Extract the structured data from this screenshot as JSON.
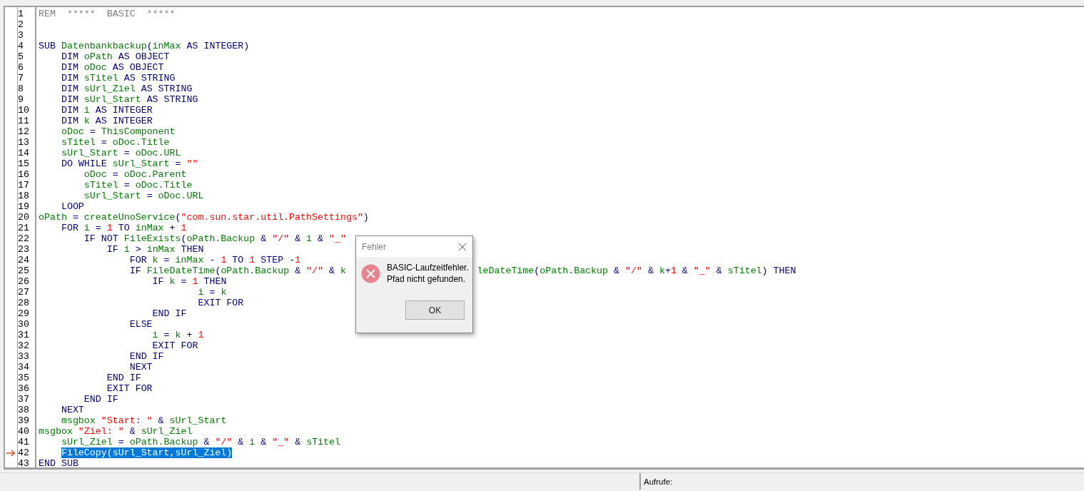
{
  "editor": {
    "lines": [
      {
        "n": "1",
        "current": false,
        "c": [
          {
            "kind": "rem",
            "t": "REM  *****  BASIC  *****"
          }
        ]
      },
      {
        "n": "2",
        "current": false
      },
      {
        "n": "3",
        "current": false
      },
      {
        "n": "4",
        "current": false,
        "c": [
          {
            "kind": "kw",
            "t": "SUB "
          },
          {
            "kind": "id",
            "t": "Datenbankbackup"
          },
          {
            "kind": "op",
            "t": "("
          },
          {
            "kind": "id",
            "t": "inMax"
          },
          {
            "kind": "kw",
            "t": " AS INTEGER)"
          }
        ]
      },
      {
        "n": "5",
        "current": false,
        "c": [
          {
            "kind": "kw",
            "t": "    DIM "
          },
          {
            "kind": "id",
            "t": "oPath"
          },
          {
            "kind": "kw",
            "t": " AS OBJECT"
          }
        ]
      },
      {
        "n": "6",
        "current": false,
        "c": [
          {
            "kind": "kw",
            "t": "    DIM "
          },
          {
            "kind": "id",
            "t": "oDoc"
          },
          {
            "kind": "kw",
            "t": " AS OBJECT"
          }
        ]
      },
      {
        "n": "7",
        "current": false,
        "c": [
          {
            "kind": "kw",
            "t": "    DIM "
          },
          {
            "kind": "id",
            "t": "sTitel"
          },
          {
            "kind": "kw",
            "t": " AS STRING"
          }
        ]
      },
      {
        "n": "8",
        "current": false,
        "c": [
          {
            "kind": "kw",
            "t": "    DIM "
          },
          {
            "kind": "id",
            "t": "sUrl_Ziel"
          },
          {
            "kind": "kw",
            "t": " AS STRING"
          }
        ]
      },
      {
        "n": "9",
        "current": false,
        "c": [
          {
            "kind": "kw",
            "t": "    DIM "
          },
          {
            "kind": "id",
            "t": "sUrl_Start"
          },
          {
            "kind": "kw",
            "t": " AS STRING"
          }
        ]
      },
      {
        "n": "10",
        "current": false,
        "c": [
          {
            "kind": "kw",
            "t": "    DIM "
          },
          {
            "kind": "id",
            "t": "i"
          },
          {
            "kind": "kw",
            "t": " AS INTEGER"
          }
        ]
      },
      {
        "n": "11",
        "current": false,
        "c": [
          {
            "kind": "kw",
            "t": "    DIM "
          },
          {
            "kind": "id",
            "t": "k"
          },
          {
            "kind": "kw",
            "t": " AS INTEGER"
          }
        ]
      },
      {
        "n": "12",
        "current": false,
        "c": [
          {
            "kind": "id",
            "t": "    oDoc"
          },
          {
            "kind": "op",
            "t": " = "
          },
          {
            "kind": "id",
            "t": "ThisComponent"
          }
        ]
      },
      {
        "n": "13",
        "current": false,
        "c": [
          {
            "kind": "id",
            "t": "    sTitel"
          },
          {
            "kind": "op",
            "t": " = "
          },
          {
            "kind": "id",
            "t": "oDoc.Title"
          }
        ]
      },
      {
        "n": "14",
        "current": false,
        "c": [
          {
            "kind": "id",
            "t": "    sUrl_Start"
          },
          {
            "kind": "op",
            "t": " = "
          },
          {
            "kind": "id",
            "t": "oDoc.URL"
          }
        ]
      },
      {
        "n": "15",
        "current": false,
        "c": [
          {
            "kind": "kw",
            "t": "    DO WHILE "
          },
          {
            "kind": "id",
            "t": "sUrl_Start"
          },
          {
            "kind": "op",
            "t": " = "
          },
          {
            "kind": "str",
            "t": "\"\""
          }
        ]
      },
      {
        "n": "16",
        "current": false,
        "c": [
          {
            "kind": "id",
            "t": "        oDoc"
          },
          {
            "kind": "op",
            "t": " = "
          },
          {
            "kind": "id",
            "t": "oDoc.Parent"
          }
        ]
      },
      {
        "n": "17",
        "current": false,
        "c": [
          {
            "kind": "id",
            "t": "        sTitel"
          },
          {
            "kind": "op",
            "t": " = "
          },
          {
            "kind": "id",
            "t": "oDoc.Title"
          }
        ]
      },
      {
        "n": "18",
        "current": false,
        "c": [
          {
            "kind": "id",
            "t": "        sUrl_Start"
          },
          {
            "kind": "op",
            "t": " = "
          },
          {
            "kind": "id",
            "t": "oDoc.URL"
          }
        ]
      },
      {
        "n": "19",
        "current": false,
        "c": [
          {
            "kind": "kw",
            "t": "    LOOP"
          }
        ]
      },
      {
        "n": "20",
        "current": false,
        "c": [
          {
            "kind": "id",
            "t": "oPath"
          },
          {
            "kind": "op",
            "t": " = "
          },
          {
            "kind": "id",
            "t": "createUnoService"
          },
          {
            "kind": "op",
            "t": "("
          },
          {
            "kind": "str",
            "t": "\"com.sun.star.util.PathSettings\""
          },
          {
            "kind": "op",
            "t": ")"
          }
        ]
      },
      {
        "n": "21",
        "current": false,
        "c": [
          {
            "kind": "kw",
            "t": "    FOR "
          },
          {
            "kind": "id",
            "t": "i"
          },
          {
            "kind": "op",
            "t": " = "
          },
          {
            "kind": "num",
            "t": "1"
          },
          {
            "kind": "kw",
            "t": " TO "
          },
          {
            "kind": "id",
            "t": "inMax"
          },
          {
            "kind": "op",
            "t": " + "
          },
          {
            "kind": "num",
            "t": "1"
          }
        ]
      },
      {
        "n": "22",
        "current": false,
        "c": [
          {
            "kind": "kw",
            "t": "        IF NOT "
          },
          {
            "kind": "id",
            "t": "FileExists"
          },
          {
            "kind": "op",
            "t": "("
          },
          {
            "kind": "id",
            "t": "oPath.Backup"
          },
          {
            "kind": "op",
            "t": " & "
          },
          {
            "kind": "str",
            "t": "\"/\""
          },
          {
            "kind": "op",
            "t": " & "
          },
          {
            "kind": "id",
            "t": "i"
          },
          {
            "kind": "op",
            "t": " & "
          },
          {
            "kind": "str",
            "t": "\"_\""
          }
        ]
      },
      {
        "n": "23",
        "current": false,
        "c": [
          {
            "kind": "kw",
            "t": "            IF "
          },
          {
            "kind": "id",
            "t": "i"
          },
          {
            "kind": "op",
            "t": " > "
          },
          {
            "kind": "id",
            "t": "inMax"
          },
          {
            "kind": "kw",
            "t": " THEN"
          }
        ]
      },
      {
        "n": "24",
        "current": false,
        "c": [
          {
            "kind": "kw",
            "t": "                FOR "
          },
          {
            "kind": "id",
            "t": "k"
          },
          {
            "kind": "op",
            "t": " = "
          },
          {
            "kind": "id",
            "t": "inMax"
          },
          {
            "kind": "op",
            "t": " - "
          },
          {
            "kind": "num",
            "t": "1"
          },
          {
            "kind": "kw",
            "t": " TO "
          },
          {
            "kind": "num",
            "t": "1"
          },
          {
            "kind": "kw",
            "t": " STEP -"
          },
          {
            "kind": "num",
            "t": "1"
          }
        ]
      },
      {
        "n": "25",
        "current": false,
        "c": [
          {
            "kind": "kw",
            "t": "                IF "
          },
          {
            "kind": "id",
            "t": "FileDateTime"
          },
          {
            "kind": "op",
            "t": "("
          },
          {
            "kind": "id",
            "t": "oPath.Backup"
          },
          {
            "kind": "op",
            "t": " & "
          },
          {
            "kind": "str",
            "t": "\"/\""
          },
          {
            "kind": "op",
            "t": " & "
          },
          {
            "kind": "id",
            "t": "k"
          },
          {
            "kind": "covered"
          },
          {
            "kind": "id",
            "t": "leDateTime"
          },
          {
            "kind": "op",
            "t": "("
          },
          {
            "kind": "id",
            "t": "oPath.Backup"
          },
          {
            "kind": "op",
            "t": " & "
          },
          {
            "kind": "str",
            "t": "\"/\""
          },
          {
            "kind": "op",
            "t": " & "
          },
          {
            "kind": "id",
            "t": "k"
          },
          {
            "kind": "op",
            "t": "+"
          },
          {
            "kind": "num",
            "t": "1"
          },
          {
            "kind": "op",
            "t": " & "
          },
          {
            "kind": "str",
            "t": "\"_\""
          },
          {
            "kind": "op",
            "t": " & "
          },
          {
            "kind": "id",
            "t": "sTitel"
          },
          {
            "kind": "op",
            "t": ") "
          },
          {
            "kind": "kw",
            "t": "THEN"
          }
        ]
      },
      {
        "n": "26",
        "current": false,
        "c": [
          {
            "kind": "kw",
            "t": "                    IF "
          },
          {
            "kind": "id",
            "t": "k"
          },
          {
            "kind": "op",
            "t": " = "
          },
          {
            "kind": "num",
            "t": "1"
          },
          {
            "kind": "kw",
            "t": " THEN"
          }
        ]
      },
      {
        "n": "27",
        "current": false,
        "c": [
          {
            "kind": "id",
            "t": "                            i"
          },
          {
            "kind": "op",
            "t": " = "
          },
          {
            "kind": "id",
            "t": "k"
          }
        ]
      },
      {
        "n": "28",
        "current": false,
        "c": [
          {
            "kind": "kw",
            "t": "                            EXIT FOR"
          }
        ]
      },
      {
        "n": "29",
        "current": false,
        "c": [
          {
            "kind": "kw",
            "t": "                    END IF"
          }
        ]
      },
      {
        "n": "30",
        "current": false,
        "c": [
          {
            "kind": "kw",
            "t": "                ELSE"
          }
        ]
      },
      {
        "n": "31",
        "current": false,
        "c": [
          {
            "kind": "id",
            "t": "                    i"
          },
          {
            "kind": "op",
            "t": " = "
          },
          {
            "kind": "id",
            "t": "k"
          },
          {
            "kind": "op",
            "t": " + "
          },
          {
            "kind": "num",
            "t": "1"
          }
        ]
      },
      {
        "n": "32",
        "current": false,
        "c": [
          {
            "kind": "kw",
            "t": "                    EXIT FOR"
          }
        ]
      },
      {
        "n": "33",
        "current": false,
        "c": [
          {
            "kind": "kw",
            "t": "                END IF"
          }
        ]
      },
      {
        "n": "34",
        "current": false,
        "c": [
          {
            "kind": "kw",
            "t": "                NEXT"
          }
        ]
      },
      {
        "n": "35",
        "current": false,
        "c": [
          {
            "kind": "kw",
            "t": "            END IF"
          }
        ]
      },
      {
        "n": "36",
        "current": false,
        "c": [
          {
            "kind": "kw",
            "t": "            EXIT FOR"
          }
        ]
      },
      {
        "n": "37",
        "current": false,
        "c": [
          {
            "kind": "kw",
            "t": "        END IF"
          }
        ]
      },
      {
        "n": "38",
        "current": false,
        "c": [
          {
            "kind": "kw",
            "t": "    NEXT"
          }
        ]
      },
      {
        "n": "39",
        "current": false,
        "c": [
          {
            "kind": "id",
            "t": "    msgbox "
          },
          {
            "kind": "str",
            "t": "\"Start: \""
          },
          {
            "kind": "op",
            "t": " & "
          },
          {
            "kind": "id",
            "t": "sUrl_Start"
          }
        ]
      },
      {
        "n": "40",
        "current": false,
        "c": [
          {
            "kind": "id",
            "t": "msgbox "
          },
          {
            "kind": "str",
            "t": "\"Ziel: \""
          },
          {
            "kind": "op",
            "t": " & "
          },
          {
            "kind": "id",
            "t": "sUrl_Ziel"
          }
        ]
      },
      {
        "n": "41",
        "current": false,
        "c": [
          {
            "kind": "id",
            "t": "    sUrl_Ziel"
          },
          {
            "kind": "op",
            "t": " = "
          },
          {
            "kind": "id",
            "t": "oPath.Backup"
          },
          {
            "kind": "op",
            "t": " & "
          },
          {
            "kind": "str",
            "t": "\"/\""
          },
          {
            "kind": "op",
            "t": " & "
          },
          {
            "kind": "id",
            "t": "i"
          },
          {
            "kind": "op",
            "t": " & "
          },
          {
            "kind": "str",
            "t": "\"_\""
          },
          {
            "kind": "op",
            "t": " & "
          },
          {
            "kind": "id",
            "t": "sTitel"
          }
        ]
      },
      {
        "n": "42",
        "current": true,
        "c": [
          {
            "kind": "sel",
            "t": "    FileCopy(sUrl_Start,sUrl_Ziel)"
          }
        ]
      },
      {
        "n": "43",
        "current": false,
        "c": [
          {
            "kind": "kw",
            "t": "END SUB"
          }
        ]
      }
    ]
  },
  "dialog": {
    "title": "Fehler",
    "message_lines": [
      "BASIC-Laufzeitfehler.",
      "Pfad nicht gefunden."
    ],
    "button": "OK"
  },
  "calls_panel": {
    "label": "Aufrufe:"
  }
}
